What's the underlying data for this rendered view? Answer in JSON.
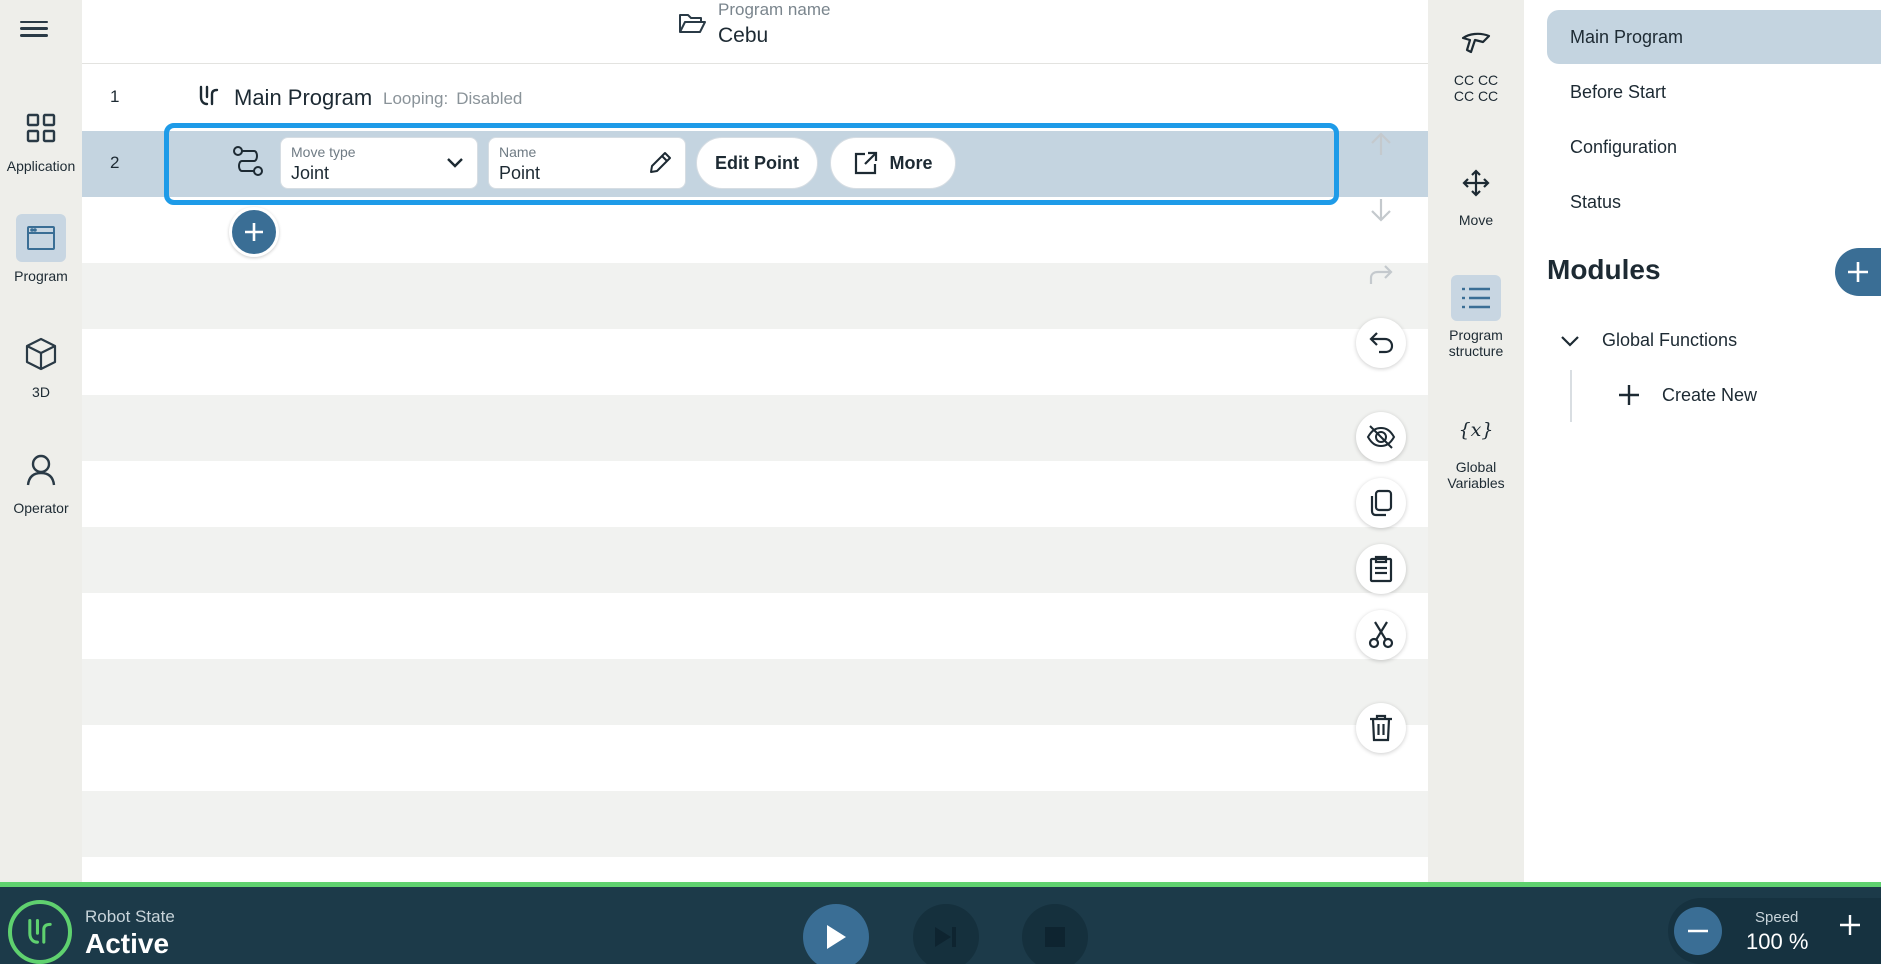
{
  "nav": {
    "items": [
      {
        "label": "Application",
        "icon": "grid-icon"
      },
      {
        "label": "Program",
        "icon": "window-icon",
        "active": true
      },
      {
        "label": "3D",
        "icon": "cube-icon"
      },
      {
        "label": "Operator",
        "icon": "person-icon"
      }
    ]
  },
  "header": {
    "program_name_label": "Program name",
    "program_name": "Cebu"
  },
  "program": {
    "rows": [
      {
        "number": "1",
        "title": "Main Program",
        "looping_label": "Looping:",
        "looping_value": "Disabled"
      },
      {
        "number": "2",
        "move_type_label": "Move type",
        "move_type_value": "Joint",
        "name_label": "Name",
        "name_value": "Point",
        "edit_point_label": "Edit Point",
        "more_label": "More"
      }
    ]
  },
  "tools": {
    "items": [
      {
        "label_line1": "CC CC",
        "label_line2": "CC CC",
        "icon": "gripper-icon"
      },
      {
        "label_line1": "Move",
        "label_line2": "",
        "icon": "move-arrows-icon"
      },
      {
        "label_line1": "Program",
        "label_line2": "structure",
        "icon": "list-icon",
        "active": true
      },
      {
        "label_line1": "Global",
        "label_line2": "Variables",
        "icon": "variable-icon"
      }
    ]
  },
  "panel": {
    "items": [
      "Main Program",
      "Before Start",
      "Configuration",
      "Status"
    ],
    "modules_title": "Modules",
    "tree_group": "Global Functions",
    "tree_create": "Create New"
  },
  "status_bar": {
    "robot_state_label": "Robot State",
    "robot_state_value": "Active",
    "speed_label": "Speed",
    "speed_value": "100 %"
  },
  "colors": {
    "accent": "#3a6e95",
    "selection_border": "#1e9be8",
    "status_ok": "#5fd16f",
    "bar_bg": "#1c3a49"
  }
}
